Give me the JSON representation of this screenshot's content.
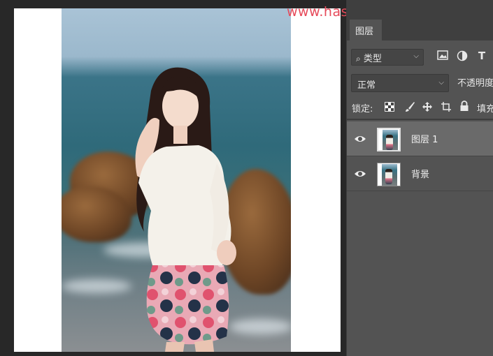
{
  "watermark": "www.hasyidianshaji.com",
  "panel": {
    "tab_label": "图层",
    "filter": {
      "label": "类型",
      "icons": [
        "search-icon",
        "image-filter-icon",
        "adjustment-filter-icon",
        "type-filter-icon"
      ]
    },
    "blend_mode": "正常",
    "opacity_label": "不透明度",
    "lock_label": "锁定:",
    "lock_icons": [
      "lock-transparent-pixels-icon",
      "lock-image-pixels-icon",
      "lock-position-icon",
      "artboard-lock-icon",
      "lock-all-icon"
    ],
    "fill_label": "填充",
    "layers": [
      {
        "name": "图层 1",
        "visible": true,
        "selected": true
      },
      {
        "name": "背景",
        "visible": true,
        "selected": false
      }
    ]
  },
  "colors": {
    "panel_bg": "#535353",
    "selected_layer_bg": "#6a6a6a",
    "watermark": "#e64a5a"
  }
}
